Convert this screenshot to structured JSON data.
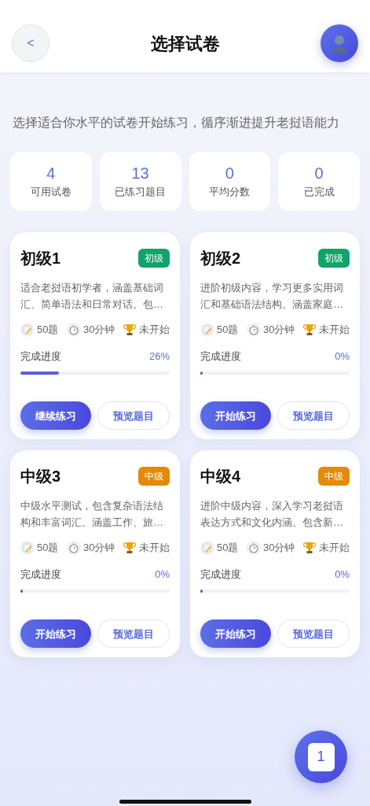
{
  "header": {
    "back": "<",
    "title": "选择试卷"
  },
  "subtitle": "选择适合你水平的试卷开始练习，循序渐进提升老挝语能力",
  "stats": [
    {
      "value": "4",
      "label": "可用试卷"
    },
    {
      "value": "13",
      "label": "已练习题目"
    },
    {
      "value": "0",
      "label": "平均分数"
    },
    {
      "value": "0",
      "label": "已完成"
    }
  ],
  "papers": [
    {
      "title": "初级1",
      "tag": "初级",
      "color": "#10a36a",
      "description": "适合老挝语初学者，涵盖基础词汇、简单语法和日常对话。包…",
      "questions": "50题",
      "duration": "30分钟",
      "status": "未开始",
      "progress_label": "完成进度",
      "progress": "26%",
      "level": 0.26,
      "primary": "继续练习",
      "secondary": "预览题目"
    },
    {
      "title": "初级2",
      "tag": "初级",
      "color": "#10a36a",
      "description": "进阶初级内容，学习更多实用词汇和基础语法结构。涵盖家庭…",
      "questions": "50题",
      "duration": "30分钟",
      "status": "未开始",
      "progress_label": "完成进度",
      "progress": "0%",
      "level": 0,
      "primary": "开始练习",
      "secondary": "预览题目"
    },
    {
      "title": "中级3",
      "tag": "中级",
      "color": "#e58a06",
      "description": "中级水平测试，包含复杂语法结构和丰富词汇。涵盖工作、旅…",
      "questions": "50题",
      "duration": "30分钟",
      "status": "未开始",
      "progress_label": "完成进度",
      "progress": "0%",
      "level": 0,
      "primary": "开始练习",
      "secondary": "预览题目"
    },
    {
      "title": "中级4",
      "tag": "中级",
      "color": "#e58a06",
      "description": "进阶中级内容，深入学习老挝语表达方式和文化内涵。包含新…",
      "questions": "50题",
      "duration": "30分钟",
      "status": "未开始",
      "progress_label": "完成进度",
      "progress": "0%",
      "level": 0,
      "primary": "开始练习",
      "secondary": "预览题目"
    }
  ],
  "fab": {
    "label": "1"
  }
}
